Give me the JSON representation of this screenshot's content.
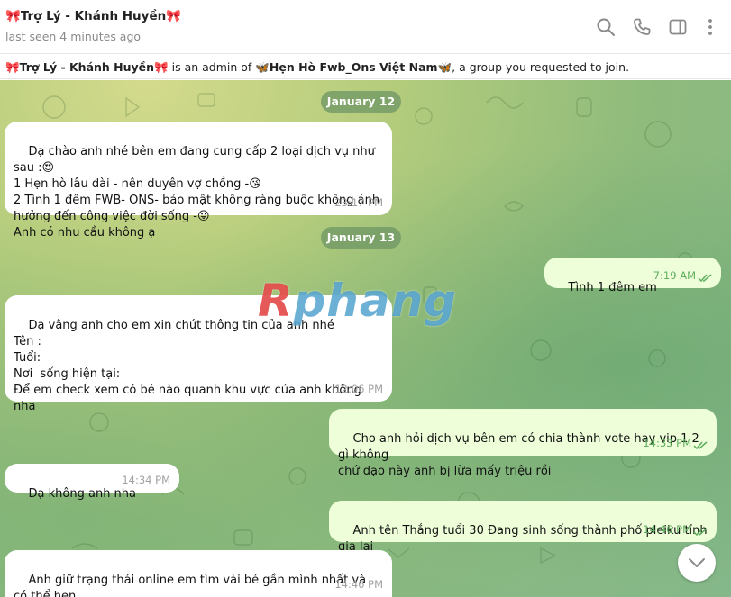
{
  "header": {
    "title_name": "Trợ Lý - Khánh Huyền",
    "title_emoji": "🎀",
    "status": "last seen 4 minutes ago",
    "icons": [
      "search-icon",
      "phone-icon",
      "sidebar-toggle-icon",
      "more-vertical-icon"
    ]
  },
  "admin_notice": {
    "emoji": "🎀",
    "name": "Trợ Lý - Khánh Huyền",
    "text_mid": " is an admin of ",
    "group_emoji": "🦋",
    "group": "Hẹn Hò Fwb_Ons Việt Nam",
    "text_end": ", a group you requested to join."
  },
  "dates": [
    "January 12",
    "January 13"
  ],
  "messages": [
    {
      "direction": "in",
      "text": "Dạ chào anh nhé bên em đang cung cấp 2 loại dịch vụ như sau :😍\n1 Hẹn hò lâu dài - nên duyên vợ chồng -😘\n2 Tình 1 đêm FWB- ONS- bảo mật không ràng buộc không ảnh\nhưởng đến công việc đời sống -😛\nAnh có nhu cầu không ạ",
      "time": "23:17 PM"
    },
    {
      "direction": "out",
      "text": "Tình 1 đêm em",
      "time": "7:19 AM",
      "status": "read"
    },
    {
      "direction": "in",
      "text": "Dạ vâng anh cho em xin chút thông tin của anh nhé\nTên :\nTuổi:\nNơi  sống hiện tại:\nĐể em check xem có bé nào quanh khu vực của anh không nha",
      "time": "12:06 PM"
    },
    {
      "direction": "out",
      "text": "Cho anh hỏi dịch vụ bên em có chia thành vote hay vip 1 2 gì không\nchứ dạo này anh bị lừa mấy triệu rồi",
      "time": "14:33 PM",
      "status": "read"
    },
    {
      "direction": "in",
      "text": "Dạ không anh nha",
      "time": "14:34 PM"
    },
    {
      "direction": "out",
      "text": "Anh tên Thắng tuổi 30 Đang sinh sống thành phố pleiku tỉnh gia lai",
      "time": "14:46 PM",
      "status": "read"
    },
    {
      "direction": "in",
      "text": "Anh giữ trạng thái online em tìm vài bé gần mình nhất và có thể hẹn\nngay bây giờ để anh chọn nha",
      "time": "14:46 PM"
    }
  ],
  "watermark": {
    "part1": "R",
    "part2": "phang"
  },
  "scroll_button": {
    "icon": "chevron-down-icon"
  },
  "colors": {
    "incoming_bubble": "#ffffff",
    "outgoing_bubble": "#eefed9",
    "outgoing_time": "#5fae5f",
    "date_pill": "#6e9664"
  }
}
